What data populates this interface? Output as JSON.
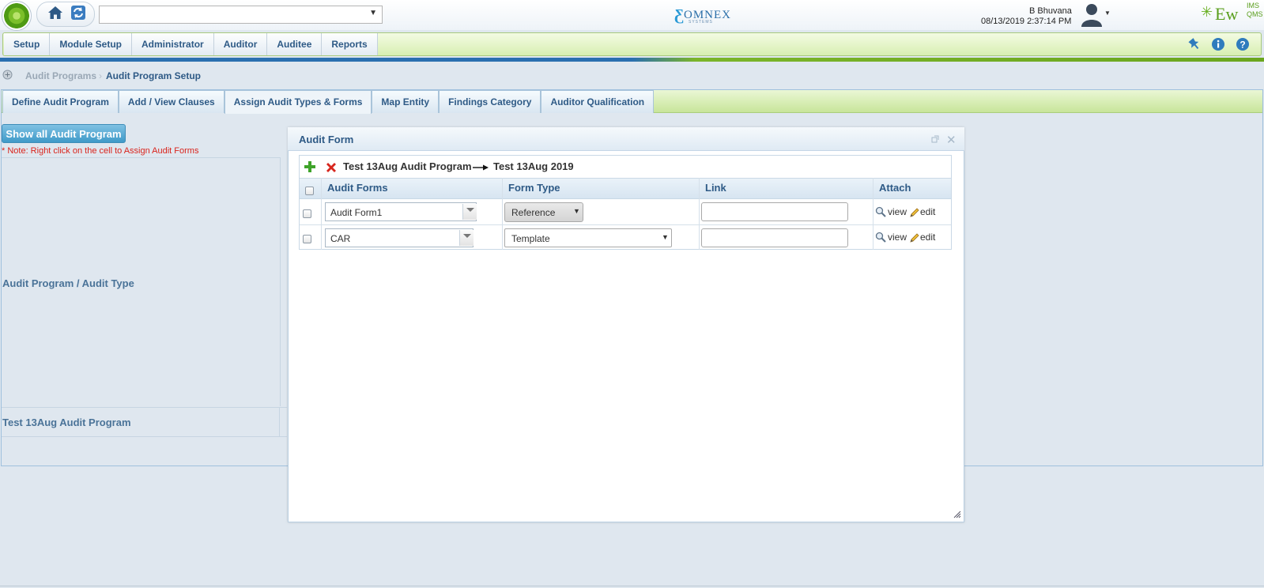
{
  "header": {
    "search_value": "",
    "brand": "OMNEX",
    "brand_sub": "SYSTEMS",
    "user_name": "B Bhuvana",
    "datetime": "08/13/2019 2:37:14 PM",
    "ew_logo_text": "Ew",
    "ew_logo_ims": "IMS",
    "ew_logo_qms": "QMS"
  },
  "nav": {
    "items": [
      {
        "label": "Setup"
      },
      {
        "label": "Module Setup"
      },
      {
        "label": "Administrator"
      },
      {
        "label": "Auditor"
      },
      {
        "label": "Auditee"
      },
      {
        "label": "Reports"
      }
    ],
    "icons": [
      "pin-icon",
      "info-icon",
      "help-icon"
    ]
  },
  "breadcrumb": {
    "parent": "Audit Programs",
    "current": "Audit Program Setup"
  },
  "tabs": [
    {
      "label": "Define Audit Program"
    },
    {
      "label": "Add / View Clauses"
    },
    {
      "label": "Assign Audit Types & Forms"
    },
    {
      "label": "Map Entity"
    },
    {
      "label": "Findings Category"
    },
    {
      "label": "Auditor Qualification"
    }
  ],
  "main": {
    "show_button": "Show all Audit Program",
    "note": "* Note: Right click on the cell to Assign Audit Forms",
    "grid_header": "Audit Program / Audit Type",
    "grid_row": "Test 13Aug Audit Program"
  },
  "dialog": {
    "title": "Audit Form",
    "program": "Test 13Aug Audit Program",
    "audit_type": "Test 13Aug 2019",
    "columns": [
      "Audit Forms",
      "Form Type",
      "Link",
      "Attach"
    ],
    "rows": [
      {
        "form": "Audit Form1",
        "form_type": "Reference",
        "link": "",
        "view": "view",
        "edit": "edit"
      },
      {
        "form": "CAR",
        "form_type": "Template",
        "link": "",
        "view": "view",
        "edit": "edit"
      }
    ]
  },
  "colors": {
    "accent_blue": "#2e5a86",
    "green_bar": "#c8e59a",
    "note_red": "#d9241c",
    "button_blue": "#3f9ac8"
  }
}
